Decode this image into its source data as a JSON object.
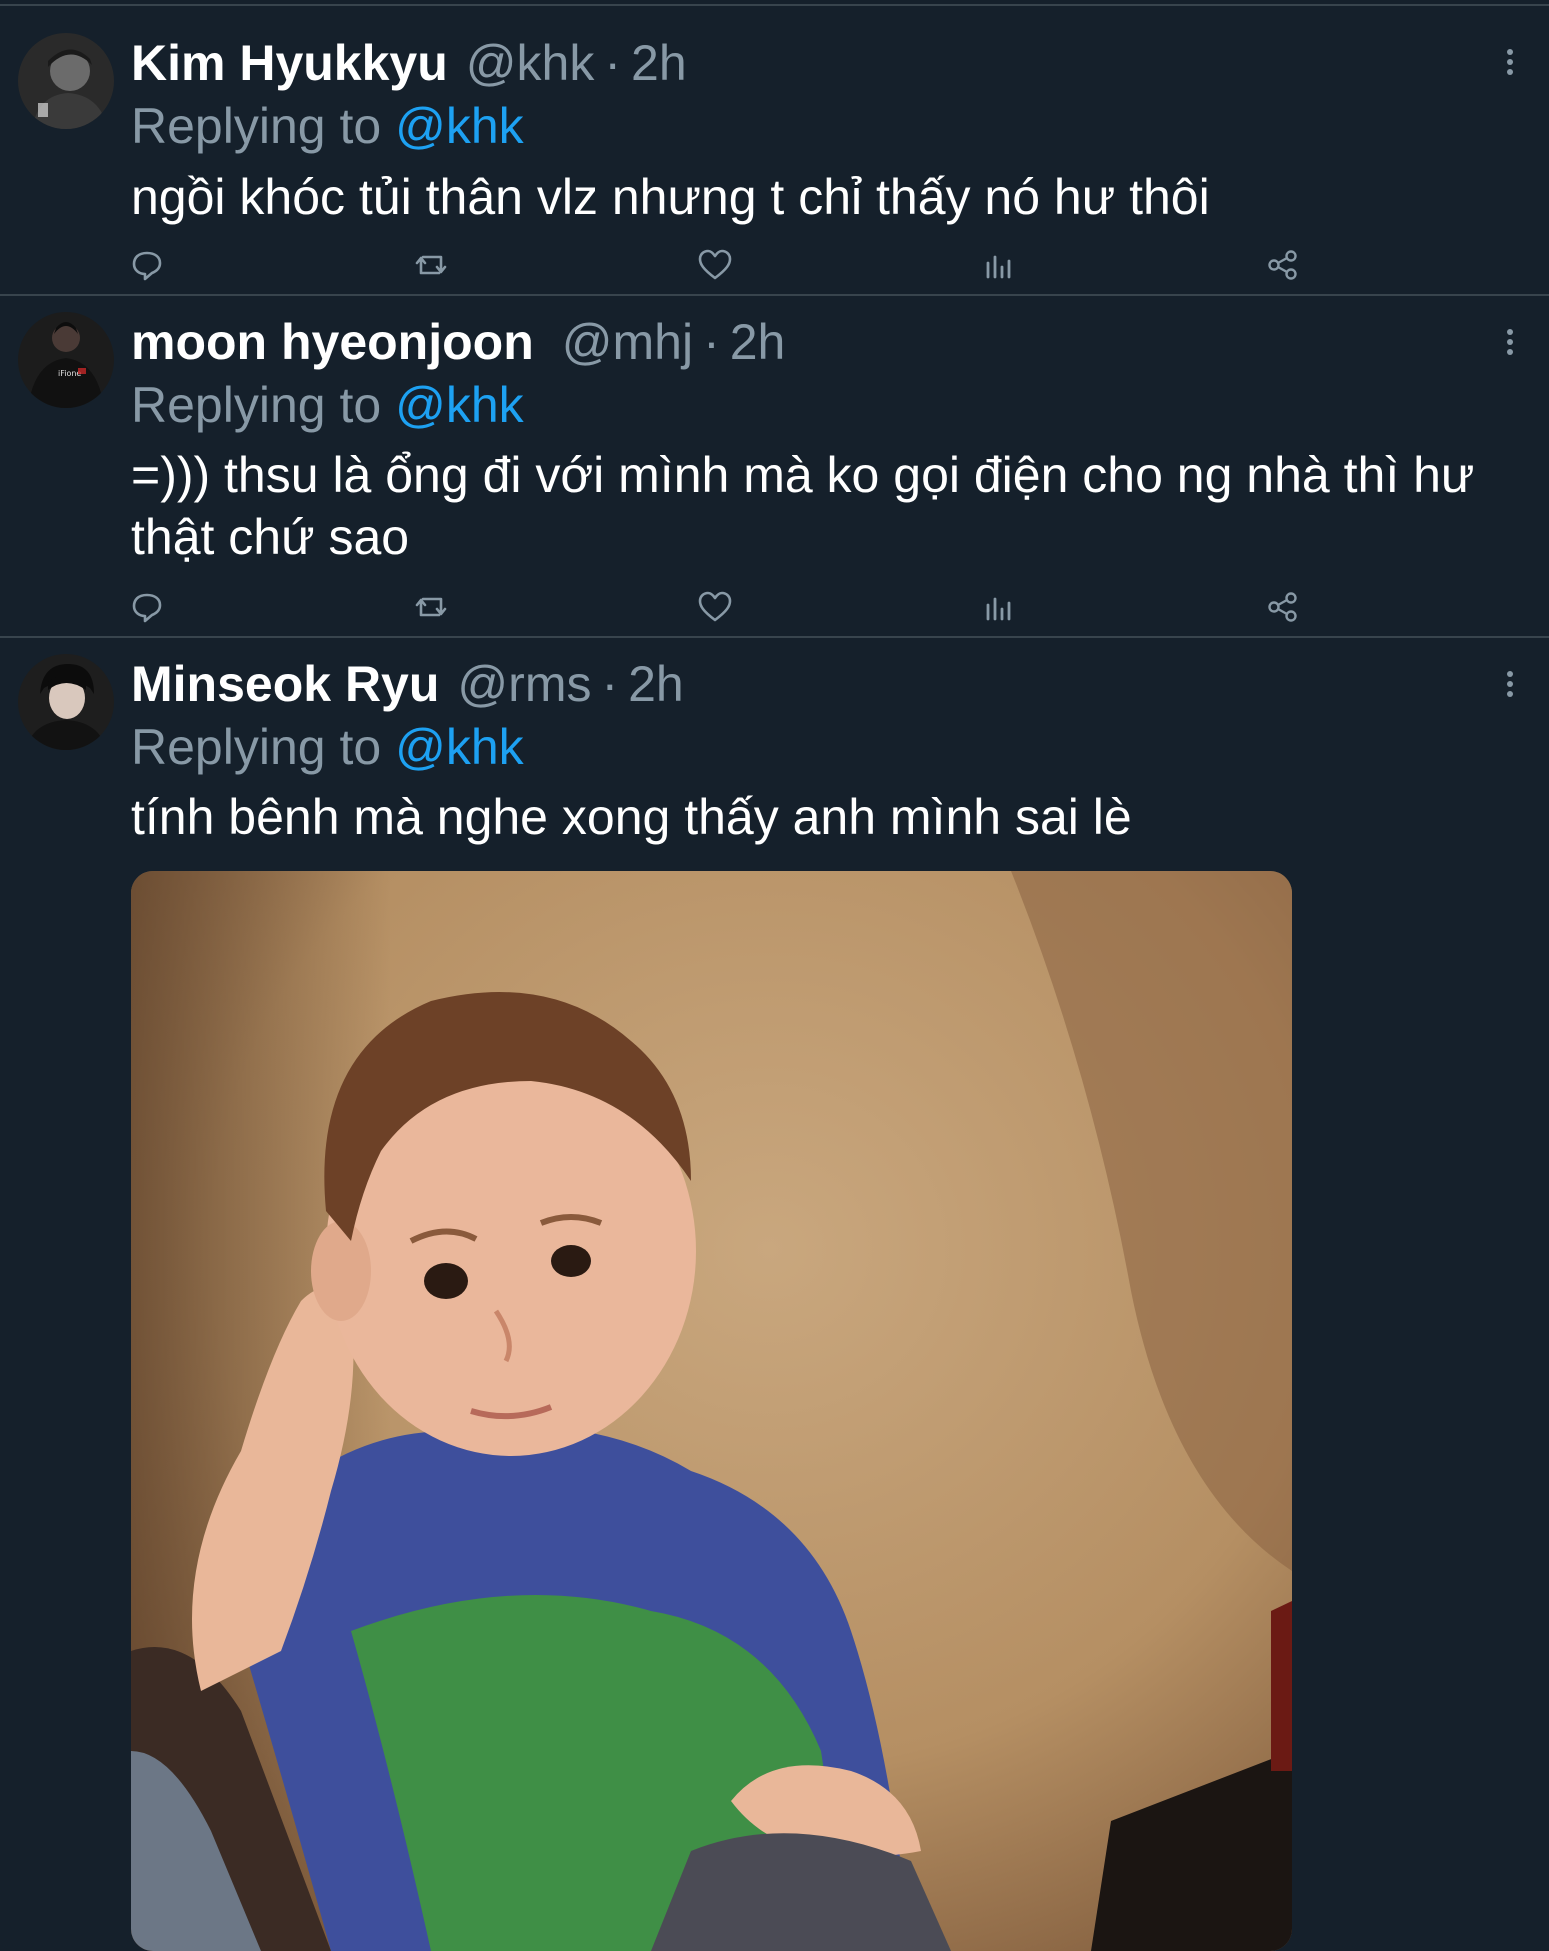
{
  "tweets": [
    {
      "name": "Kim Hyukkyu",
      "handle": "@khk",
      "separator": "·",
      "time": "2h",
      "replying_prefix": "Replying to",
      "replying_handle": "@khk",
      "text": "ngồi khóc tủi thân vlz nhưng t chỉ thấy nó hư thôi"
    },
    {
      "name": "moon hyeonjoon",
      "handle": "@mhj",
      "separator": "·",
      "time": "2h",
      "replying_prefix": "Replying to",
      "replying_handle": "@khk",
      "text": "=))) thsu là ổng đi với mình mà ko gọi điện cho ng nhà thì hư thật chứ sao"
    },
    {
      "name": "Minseok Ryu",
      "handle": "@rms",
      "separator": "·",
      "time": "2h",
      "replying_prefix": "Replying to",
      "replying_handle": "@khk",
      "text": "tính bênh mà nghe xong thấy anh mình sai lè",
      "media": {
        "icon": "meme-photo-child-thinking"
      }
    }
  ],
  "action_icons": [
    "reply-icon",
    "retweet-icon",
    "like-icon",
    "analytics-icon",
    "share-icon"
  ],
  "colors": {
    "background": "#15202b",
    "divider": "#38444d",
    "secondary_text": "#8899a6",
    "accent": "#1da1f2",
    "primary_text": "#ffffff"
  }
}
